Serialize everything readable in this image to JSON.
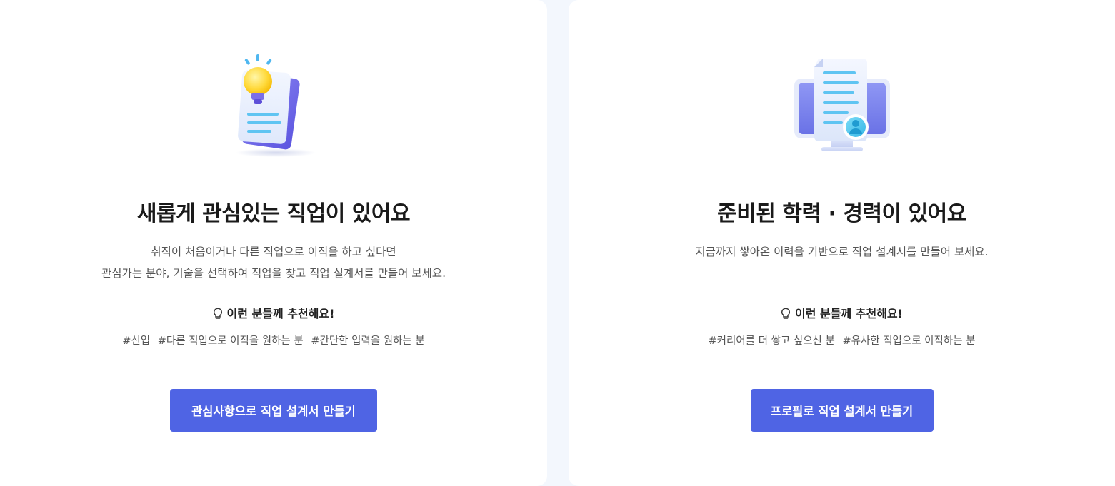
{
  "cards": [
    {
      "title": "새롭게 관심있는 직업이 있어요",
      "description": [
        "취직이 처음이거나 다른 직업으로 이직을 하고 싶다면",
        "관심가는 분야, 기술을 선택하여 직업을 찾고 직업 설계서를 만들어 보세요."
      ],
      "recommend_label": "이런 분들께 추천해요!",
      "tags": [
        "#신입",
        "#다른 직업으로 이직을 원하는 분",
        "#간단한 입력을 원하는 분"
      ],
      "button_label": "관심사항으로 직업 설계서 만들기",
      "icon": "lightbulb-document-icon"
    },
    {
      "title": "준비된 학력 · 경력이 있어요",
      "description": [
        "지금까지 쌓아온 이력을 기반으로 직업 설계서를 만들어 보세요."
      ],
      "recommend_label": "이런 분들께 추천해요!",
      "tags": [
        "#커리어를 더 쌓고 싶으신 분",
        "#유사한 직업으로 이직하는 분"
      ],
      "button_label": "프로필로 직업 설계서 만들기",
      "icon": "resume-monitor-icon"
    }
  ],
  "colors": {
    "accent": "#4f64e4",
    "page_background": "#f3f7fd",
    "card_background": "#ffffff"
  }
}
